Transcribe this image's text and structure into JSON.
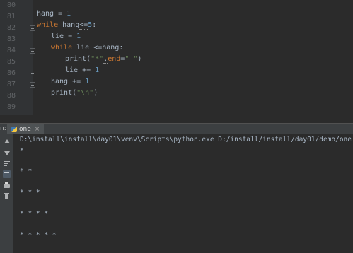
{
  "editor": {
    "line_numbers": [
      "80",
      "81",
      "82",
      "83",
      "84",
      "85",
      "86",
      "87",
      "88",
      "89"
    ],
    "code": {
      "l80": {
        "a": "hang = ",
        "b": "1"
      },
      "l81": {
        "kw": "while",
        "a": " hang",
        "b": "<=",
        "c": "5",
        "d": ":"
      },
      "l82": {
        "a": "lie = ",
        "b": "1"
      },
      "l83": {
        "kw": "while",
        "a": " lie <=",
        "b": "hang",
        "c": ":"
      },
      "l84": {
        "a": "print(",
        "s1": "\"*\"",
        "c1": ",",
        "kw": "end",
        "c2": "=",
        "s2": "\" \"",
        "e": ")"
      },
      "l85": {
        "a": "lie += ",
        "b": "1"
      },
      "l86": {
        "a": "hang += ",
        "b": "1"
      },
      "l87": {
        "a": "print(",
        "s": "\"\\n\"",
        "e": ")"
      }
    }
  },
  "run_panel": {
    "label_prefix": "n:",
    "tab_label": "one",
    "tab_close": "×"
  },
  "console": {
    "command": "D:\\install\\install\\day01\\venv\\Scripts\\python.exe D:/install/install/day01/demo/one.py",
    "output": [
      "*",
      "* *",
      "* * *",
      "* * * *",
      "* * * * *"
    ]
  },
  "colors": {
    "background": "#2b2b2b",
    "keyword": "#cc7832",
    "number": "#6897bb",
    "string": "#6a8759",
    "text": "#a9b7c6"
  }
}
